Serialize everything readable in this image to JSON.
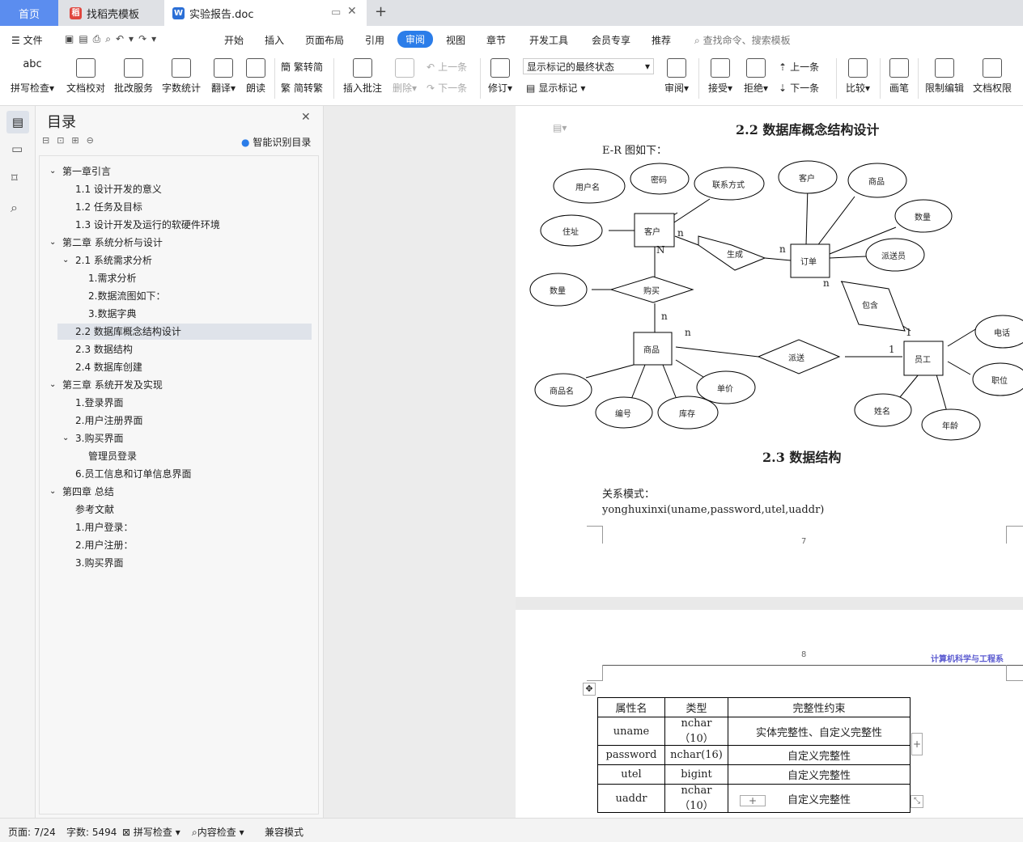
{
  "tabs": [
    {
      "label": "首页"
    },
    {
      "label": "找稻壳模板"
    },
    {
      "label": "实验报告.doc"
    }
  ],
  "menu": {
    "file": "文件",
    "items": [
      "开始",
      "插入",
      "页面布局",
      "引用",
      "审阅",
      "视图",
      "章节",
      "开发工具",
      "会员专享",
      "推荐"
    ],
    "search": "查找命令、搜索模板"
  },
  "ribbon": {
    "spell": "拼写检查",
    "proof": "文档校对",
    "batch": "批改服务",
    "wordcount": "字数统计",
    "translate": "翻译",
    "read": "朗读",
    "t2s": "繁转简",
    "s2t": "简转繁",
    "insert_comment": "插入批注",
    "delete": "删除",
    "prev1": "上一条",
    "next1": "下一条",
    "revise": "修订",
    "markup_state": "显示标记的最终状态",
    "show_markup": "显示标记",
    "review": "审阅",
    "accept": "接受",
    "reject": "拒绝",
    "prev2": "上一条",
    "next2": "下一条",
    "compare": "比较",
    "pen": "画笔",
    "restrict": "限制编辑",
    "rights": "文档权限",
    "abc": "abc"
  },
  "toc": {
    "title": "目录",
    "smart": "智能识别目录",
    "items": [
      {
        "label": "第一章引言",
        "level": 0,
        "expand": true
      },
      {
        "label": "1.1  设计开发的意义",
        "level": 1
      },
      {
        "label": "1.2  任务及目标",
        "level": 1
      },
      {
        "label": "1.3  设计开发及运行的软硬件环境",
        "level": 1
      },
      {
        "label": "第二章  系统分析与设计",
        "level": 0,
        "expand": true
      },
      {
        "label": "2.1  系统需求分析",
        "level": 1,
        "expand": true
      },
      {
        "label": "1.需求分析",
        "level": 2
      },
      {
        "label": "2.数据流图如下：",
        "level": 2
      },
      {
        "label": "3.数据字典",
        "level": 2
      },
      {
        "label": "2.2  数据库概念结构设计",
        "level": 1,
        "selected": true
      },
      {
        "label": "2.3  数据结构",
        "level": 1
      },
      {
        "label": "2.4  数据库创建",
        "level": 1
      },
      {
        "label": "第三章  系统开发及实现",
        "level": 0,
        "expand": true
      },
      {
        "label": "1.登录界面",
        "level": 1
      },
      {
        "label": "2.用户注册界面",
        "level": 1
      },
      {
        "label": "3.购买界面",
        "level": 1,
        "expand": true
      },
      {
        "label": "管理员登录",
        "level": 2
      },
      {
        "label": "6.员工信息和订单信息界面",
        "level": 1
      },
      {
        "label": "第四章  总结",
        "level": 0,
        "expand": true
      },
      {
        "label": "参考文献",
        "level": 1
      },
      {
        "label": "1.用户登录：",
        "level": 1
      },
      {
        "label": "2.用户注册：",
        "level": 1
      },
      {
        "label": "3.购买界面",
        "level": 1
      }
    ]
  },
  "doc": {
    "h22": "2.2  数据库概念结构设计",
    "er_intro": "E-R 图如下：",
    "h23": "2.3  数据结构",
    "rel_label": "关系模式：",
    "rel_schema": "yonghuxinxi(uname,password,utel,uaddr)",
    "page7": "7",
    "page8": "8",
    "header_right": "计算机科学与工程系"
  },
  "er": {
    "entities": [
      "客户",
      "订单",
      "商品",
      "员工"
    ],
    "relations": [
      "生成",
      "购买",
      "包含",
      "派送"
    ],
    "attrs": [
      "用户名",
      "密码",
      "联系方式",
      "住址",
      "客户",
      "商品",
      "数量",
      "派送员",
      "数量",
      "电话",
      "职位",
      "姓名",
      "年龄",
      "商品名",
      "编号",
      "库存",
      "单价"
    ],
    "cards": [
      "n",
      "n",
      "N",
      "n",
      "n",
      "n",
      "1",
      "1",
      "n"
    ]
  },
  "table": {
    "headers": [
      "属性名",
      "类型",
      "完整性约束"
    ],
    "rows": [
      [
        "uname",
        "nchar（10）",
        "实体完整性、自定义完整性"
      ],
      [
        "password",
        "nchar(16)",
        "自定义完整性"
      ],
      [
        "utel",
        "bigint",
        "自定义完整性"
      ],
      [
        "uaddr",
        "nchar（10）",
        "自定义完整性"
      ]
    ]
  },
  "status": {
    "page": "页面: 7/24",
    "words": "字数: 5494",
    "spell": "拼写检查",
    "content": "内容检查",
    "compat": "兼容模式"
  },
  "colors": {
    "accent": "#2b7de9",
    "selected": "#dfe3ea"
  }
}
